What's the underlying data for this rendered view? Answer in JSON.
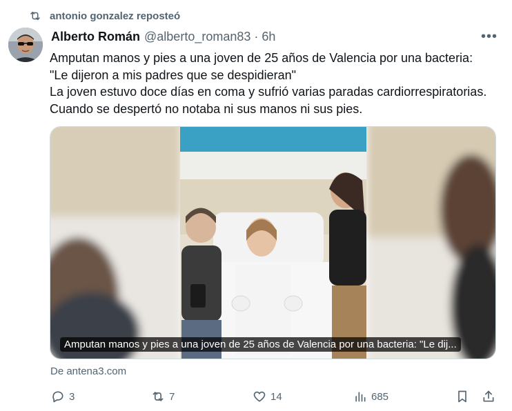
{
  "repost": {
    "label": "antonio gonzalez reposteó",
    "icon": "repost-icon"
  },
  "author": {
    "name": "Alberto Román",
    "handle": "@alberto_roman83",
    "separator": "·",
    "time": "6h"
  },
  "more_label": "•••",
  "tweet": {
    "lines": [
      "Amputan manos y pies a una joven de 25 años de Valencia por una bacteria:",
      "\"Le dijeron a mis padres que se despidieran\"",
      "La joven estuvo doce días en coma y sufrió varias paradas cardiorrespiratorias.",
      "Cuando se despertó no notaba ni sus manos ni sus pies."
    ]
  },
  "media": {
    "caption": "Amputan manos y pies a una joven de 25 años de Valencia por una bacteria: \"Le dij..."
  },
  "source": "De antena3.com",
  "actions": {
    "reply": {
      "count": "3",
      "icon": "reply-icon"
    },
    "repost": {
      "count": "7",
      "icon": "repost-icon"
    },
    "like": {
      "count": "14",
      "icon": "heart-icon"
    },
    "views": {
      "count": "685",
      "icon": "views-icon"
    },
    "bookmark": {
      "icon": "bookmark-icon"
    },
    "share": {
      "icon": "share-icon"
    }
  },
  "colors": {
    "text": "#0f1419",
    "secondary": "#536471",
    "border": "#cfd9de"
  }
}
